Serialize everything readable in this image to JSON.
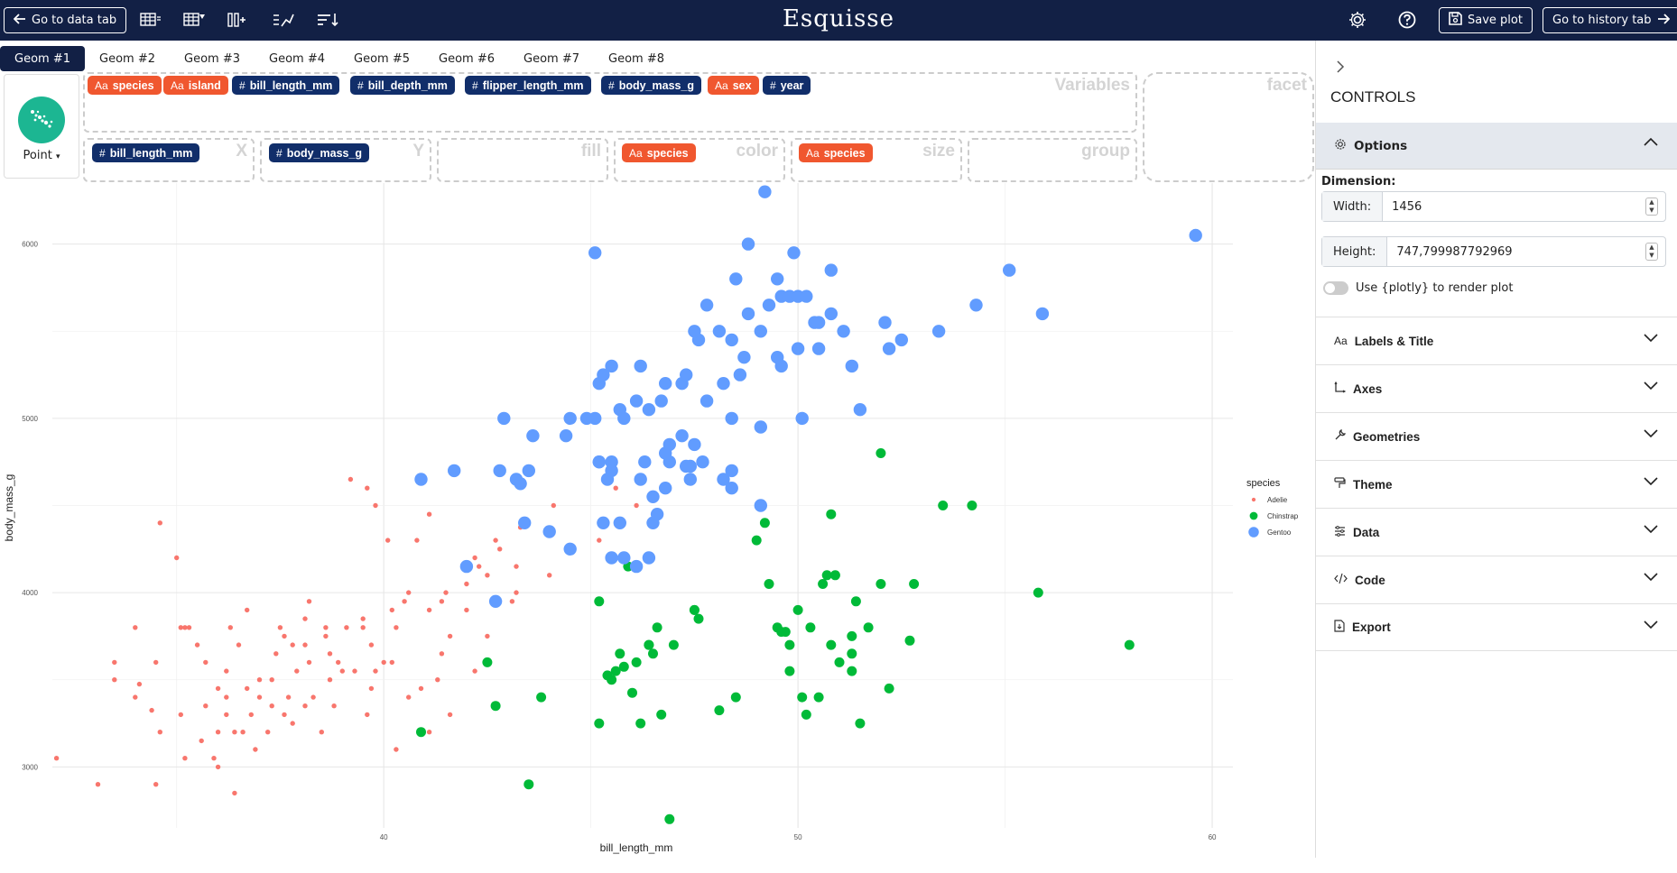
{
  "topbar": {
    "data_tab_label": "Go to data tab",
    "app_title": "Esquisse",
    "save_label": "Save plot",
    "history_label": "Go to history tab"
  },
  "geom_tabs": [
    "Geom #1",
    "Geom #2",
    "Geom #3",
    "Geom #4",
    "Geom #5",
    "Geom #6",
    "Geom #7",
    "Geom #8"
  ],
  "geom": {
    "label": "Point"
  },
  "variables": [
    {
      "name": "species",
      "type": "txt"
    },
    {
      "name": "island",
      "type": "txt"
    },
    {
      "name": "bill_length_mm",
      "type": "num"
    },
    {
      "name": "bill_depth_mm",
      "type": "num"
    },
    {
      "name": "flipper_length_mm",
      "type": "num"
    },
    {
      "name": "body_mass_g",
      "type": "num"
    },
    {
      "name": "sex",
      "type": "txt"
    },
    {
      "name": "year",
      "type": "num"
    }
  ],
  "dropzones": {
    "variables_label": "Variables",
    "facet_label": "facet",
    "x_label": "X",
    "y_label": "Y",
    "fill_label": "fill",
    "color_label": "color",
    "size_label": "size",
    "group_label": "group",
    "x_value": "bill_length_mm",
    "y_value": "body_mass_g",
    "color_value": "species",
    "size_value": "species"
  },
  "controls": {
    "title": "CONTROLS",
    "options_label": "Options",
    "dimension_label": "Dimension:",
    "width_label": "Width:",
    "width_value": "1456",
    "height_label": "Height:",
    "height_value": "747,799987792969",
    "plotly_label": "Use {plotly} to render plot",
    "sections": [
      "Labels & Title",
      "Axes",
      "Geometries",
      "Theme",
      "Data",
      "Code",
      "Export"
    ]
  },
  "chart_data": {
    "type": "scatter",
    "xlabel": "bill_length_mm",
    "ylabel": "body_mass_g",
    "xlim": [
      32,
      60.5
    ],
    "ylim": [
      2650,
      6350
    ],
    "xticks": [
      40,
      50,
      60
    ],
    "yticks": [
      3000,
      4000,
      5000,
      6000
    ],
    "grid": true,
    "legend": {
      "title": "species",
      "position": "right"
    },
    "series": [
      {
        "name": "Adelie",
        "color": "#f8766d",
        "size": "small",
        "points": [
          [
            32.1,
            3050
          ],
          [
            33.1,
            2900
          ],
          [
            33.5,
            3600
          ],
          [
            34,
            3400
          ],
          [
            34.1,
            3475
          ],
          [
            34.4,
            3325
          ],
          [
            34.5,
            2900
          ],
          [
            34.6,
            4400
          ],
          [
            34.6,
            3200
          ],
          [
            35,
            4200
          ],
          [
            35.1,
            3800
          ],
          [
            35.2,
            3050
          ],
          [
            35.3,
            3800
          ],
          [
            35.5,
            3700
          ],
          [
            35.6,
            3150
          ],
          [
            35.7,
            3350
          ],
          [
            35.9,
            3050
          ],
          [
            36,
            3450
          ],
          [
            36,
            3000
          ],
          [
            36.2,
            3550
          ],
          [
            36.2,
            3300
          ],
          [
            36.3,
            3800
          ],
          [
            36.4,
            2850
          ],
          [
            36.5,
            3700
          ],
          [
            36.6,
            3200
          ],
          [
            36.7,
            3450
          ],
          [
            36.8,
            3300
          ],
          [
            37,
            3500
          ],
          [
            37.2,
            3200
          ],
          [
            37.3,
            3350
          ],
          [
            37.6,
            3750
          ],
          [
            37.7,
            3400
          ],
          [
            37.8,
            3700
          ],
          [
            37.8,
            3250
          ],
          [
            38.1,
            3350
          ],
          [
            38.1,
            3700
          ],
          [
            38.2,
            3950
          ],
          [
            38.5,
            3200
          ],
          [
            38.6,
            3800
          ],
          [
            38.7,
            3650
          ],
          [
            38.8,
            3350
          ],
          [
            39,
            3550
          ],
          [
            39.2,
            4650
          ],
          [
            39.3,
            3550
          ],
          [
            39.5,
            3800
          ],
          [
            39.6,
            4600
          ],
          [
            39.7,
            3700
          ],
          [
            39.8,
            4500
          ],
          [
            40.1,
            4300
          ],
          [
            40.2,
            3900
          ],
          [
            40.3,
            3800
          ],
          [
            40.5,
            3950
          ],
          [
            40.6,
            4000
          ],
          [
            40.8,
            4300
          ],
          [
            41.1,
            3900
          ],
          [
            41.1,
            4450
          ],
          [
            41.4,
            3950
          ],
          [
            41.5,
            4000
          ],
          [
            41.6,
            3750
          ],
          [
            42,
            4050
          ],
          [
            42.2,
            4200
          ],
          [
            42.5,
            4100
          ],
          [
            42.8,
            4250
          ],
          [
            43.1,
            3950
          ],
          [
            43.2,
            4000
          ],
          [
            43.3,
            4375
          ],
          [
            44.1,
            4500
          ],
          [
            45.6,
            4600
          ],
          [
            46,
            4150
          ],
          [
            33.5,
            3500
          ],
          [
            34.5,
            3600
          ],
          [
            35.2,
            3800
          ],
          [
            35.7,
            3600
          ],
          [
            36,
            3200
          ],
          [
            36.2,
            3400
          ],
          [
            36.7,
            3900
          ],
          [
            37,
            3400
          ],
          [
            37.3,
            3500
          ],
          [
            37.6,
            3300
          ],
          [
            37.9,
            3550
          ],
          [
            38.1,
            3850
          ],
          [
            38.3,
            3400
          ],
          [
            38.6,
            3750
          ],
          [
            38.9,
            3600
          ],
          [
            39.1,
            3800
          ],
          [
            39.6,
            3300
          ],
          [
            39.7,
            3450
          ],
          [
            40,
            3600
          ],
          [
            40.3,
            3100
          ],
          [
            40.6,
            3400
          ],
          [
            40.9,
            3450
          ],
          [
            41.1,
            3200
          ],
          [
            41.4,
            3650
          ],
          [
            41.6,
            3300
          ],
          [
            42,
            3900
          ],
          [
            42.2,
            3550
          ],
          [
            42.3,
            4150
          ],
          [
            42.7,
            4300
          ],
          [
            43.2,
            4150
          ],
          [
            44,
            4100
          ],
          [
            45.2,
            4300
          ],
          [
            46.1,
            4500
          ],
          [
            36.4,
            3200
          ],
          [
            37.5,
            3800
          ],
          [
            38.2,
            3600
          ],
          [
            39.5,
            3850
          ],
          [
            40.2,
            3600
          ],
          [
            34,
            3800
          ],
          [
            35.1,
            3300
          ],
          [
            36.9,
            3100
          ],
          [
            37.4,
            3650
          ],
          [
            38.7,
            3500
          ],
          [
            39.8,
            3550
          ],
          [
            41.3,
            3500
          ],
          [
            42.5,
            3750
          ]
        ]
      },
      {
        "name": "Chinstrap",
        "color": "#00ba38",
        "size": "medium",
        "points": [
          [
            40.9,
            3200
          ],
          [
            42.5,
            3600
          ],
          [
            42.7,
            3350
          ],
          [
            43.5,
            2900
          ],
          [
            43.8,
            3400
          ],
          [
            45.2,
            3950
          ],
          [
            45.2,
            3250
          ],
          [
            45.4,
            3525
          ],
          [
            45.5,
            3500
          ],
          [
            45.6,
            3550
          ],
          [
            45.7,
            3650
          ],
          [
            45.8,
            3575
          ],
          [
            46,
            3425
          ],
          [
            46.1,
            3600
          ],
          [
            46.2,
            3250
          ],
          [
            46.4,
            3700
          ],
          [
            46.5,
            3650
          ],
          [
            46.6,
            3800
          ],
          [
            46.7,
            3300
          ],
          [
            46.9,
            2700
          ],
          [
            47,
            3700
          ],
          [
            47.5,
            3900
          ],
          [
            48.1,
            3325
          ],
          [
            48.5,
            3400
          ],
          [
            49,
            4300
          ],
          [
            49.2,
            4400
          ],
          [
            49.3,
            4050
          ],
          [
            49.5,
            3800
          ],
          [
            49.7,
            3775
          ],
          [
            49.8,
            3700
          ],
          [
            50,
            3900
          ],
          [
            50.1,
            3400
          ],
          [
            50.2,
            3300
          ],
          [
            50.3,
            3800
          ],
          [
            50.5,
            3400
          ],
          [
            50.6,
            4050
          ],
          [
            50.7,
            4100
          ],
          [
            50.8,
            4450
          ],
          [
            50.9,
            4100
          ],
          [
            51.3,
            3550
          ],
          [
            51.4,
            3950
          ],
          [
            51.5,
            3250
          ],
          [
            51.7,
            3800
          ],
          [
            52,
            4800
          ],
          [
            52,
            4050
          ],
          [
            52.2,
            3450
          ],
          [
            52.7,
            3725
          ],
          [
            53.5,
            4500
          ],
          [
            54.2,
            4500
          ],
          [
            55.8,
            4000
          ],
          [
            58,
            3700
          ],
          [
            51.3,
            3650
          ],
          [
            51,
            3600
          ],
          [
            49.6,
            3775
          ],
          [
            47.6,
            3850
          ],
          [
            50.8,
            3700
          ],
          [
            45.9,
            4150
          ],
          [
            49.8,
            3550
          ],
          [
            46.4,
            3700
          ],
          [
            51.3,
            3750
          ],
          [
            47.5,
            3900
          ],
          [
            52.8,
            4050
          ]
        ]
      },
      {
        "name": "Gentoo",
        "color": "#619cff",
        "size": "large",
        "points": [
          [
            40.9,
            4650
          ],
          [
            41.7,
            4700
          ],
          [
            42,
            4150
          ],
          [
            42.7,
            3950
          ],
          [
            42.8,
            4700
          ],
          [
            42.9,
            5000
          ],
          [
            43.2,
            4650
          ],
          [
            43.3,
            4625
          ],
          [
            43.4,
            4400
          ],
          [
            43.5,
            4700
          ],
          [
            43.6,
            4900
          ],
          [
            44,
            4350
          ],
          [
            44.4,
            4900
          ],
          [
            44.5,
            4250
          ],
          [
            45.1,
            5000
          ],
          [
            45.2,
            5200
          ],
          [
            45.2,
            4750
          ],
          [
            45.3,
            4400
          ],
          [
            45.4,
            4650
          ],
          [
            45.5,
            4750
          ],
          [
            45.5,
            5300
          ],
          [
            45.7,
            5050
          ],
          [
            45.8,
            4200
          ],
          [
            45.8,
            5000
          ],
          [
            46.1,
            5100
          ],
          [
            46.2,
            4650
          ],
          [
            46.2,
            5300
          ],
          [
            46.4,
            4200
          ],
          [
            46.5,
            4400
          ],
          [
            46.7,
            5100
          ],
          [
            46.8,
            4800
          ],
          [
            47.2,
            5200
          ],
          [
            47.3,
            4725
          ],
          [
            47.4,
            4725
          ],
          [
            47.5,
            4850
          ],
          [
            47.6,
            5450
          ],
          [
            47.7,
            4750
          ],
          [
            47.8,
            5650
          ],
          [
            48.1,
            5500
          ],
          [
            48.2,
            4650
          ],
          [
            48.4,
            5000
          ],
          [
            48.5,
            5800
          ],
          [
            48.7,
            5350
          ],
          [
            48.8,
            6000
          ],
          [
            49.1,
            5500
          ],
          [
            49.2,
            6300
          ],
          [
            49.3,
            5650
          ],
          [
            49.5,
            5350
          ],
          [
            49.6,
            5700
          ],
          [
            49.8,
            5700
          ],
          [
            50,
            5700
          ],
          [
            50.1,
            5000
          ],
          [
            50.2,
            5700
          ],
          [
            50.4,
            5550
          ],
          [
            50.5,
            5550
          ],
          [
            50.8,
            5600
          ],
          [
            51.1,
            5500
          ],
          [
            51.3,
            5300
          ],
          [
            51.5,
            5050
          ],
          [
            52.1,
            5550
          ],
          [
            52.2,
            5400
          ],
          [
            52.5,
            5450
          ],
          [
            53.4,
            5500
          ],
          [
            54.3,
            5650
          ],
          [
            55.1,
            5850
          ],
          [
            55.9,
            5600
          ],
          [
            59.6,
            6050
          ],
          [
            45.1,
            5950
          ],
          [
            47.2,
            4900
          ],
          [
            46.1,
            4150
          ],
          [
            46.9,
            4850
          ],
          [
            48.4,
            4600
          ],
          [
            49.1,
            4500
          ],
          [
            49.6,
            5300
          ],
          [
            50,
            5400
          ],
          [
            50.8,
            5850
          ],
          [
            48.6,
            5250
          ],
          [
            46.6,
            4450
          ],
          [
            47.5,
            5500
          ],
          [
            45.3,
            5250
          ],
          [
            47.4,
            4650
          ],
          [
            49.1,
            4950
          ],
          [
            48.4,
            5450
          ],
          [
            46.5,
            4550
          ],
          [
            50.5,
            5400
          ],
          [
            49.9,
            5950
          ],
          [
            45.7,
            4400
          ],
          [
            46.4,
            5050
          ],
          [
            48.2,
            5200
          ],
          [
            47.3,
            5250
          ],
          [
            46.9,
            4750
          ],
          [
            45.5,
            4200
          ],
          [
            44.9,
            5000
          ],
          [
            46.8,
            5200
          ],
          [
            45.5,
            4700
          ],
          [
            48.8,
            5600
          ],
          [
            48.4,
            4700
          ],
          [
            47.8,
            5100
          ],
          [
            46.3,
            4750
          ],
          [
            49.5,
            5800
          ],
          [
            45.2,
            4750
          ],
          [
            46.8,
            4600
          ],
          [
            44.5,
            5000
          ]
        ]
      }
    ]
  }
}
